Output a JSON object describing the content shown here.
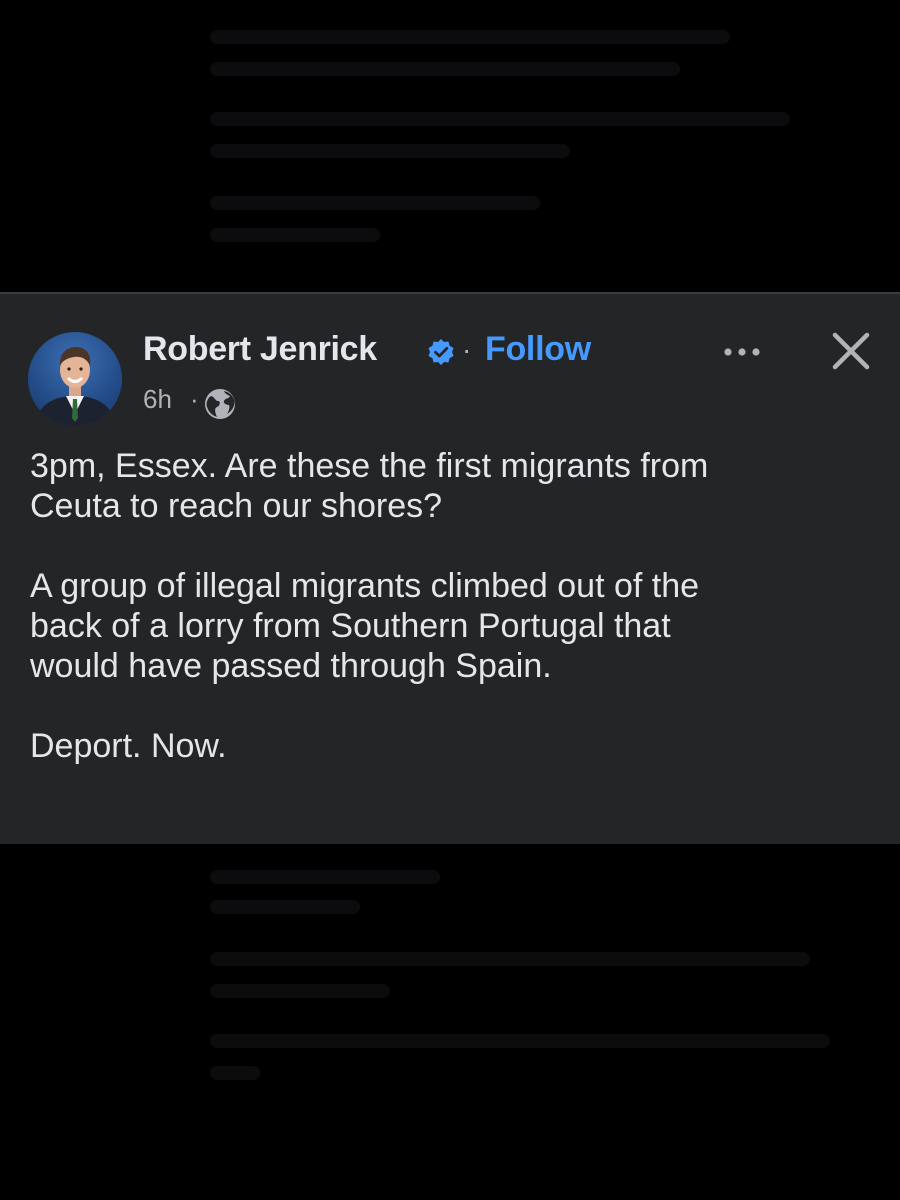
{
  "post": {
    "author": "Robert Jenrick",
    "separator": "·",
    "follow_label": "Follow",
    "time": "6h",
    "time_separator": "·",
    "paragraphs": [
      "3pm, Essex. Are these the first migrants from\nCeuta to reach our shores?",
      "A group of illegal migrants climbed out of the\nback of a lorry from Southern Portugal that\nwould have passed through Spain.",
      "Deport. Now."
    ]
  },
  "icons": {
    "verified": "verified-badge-icon",
    "more": "more-options-icon",
    "close": "close-icon",
    "audience": "globe-icon"
  },
  "colors": {
    "card_background": "#242527",
    "page_background": "#000000",
    "primary_text": "#e4e6eb",
    "secondary_text": "#b0b3b8",
    "link_blue": "#4599ff"
  }
}
